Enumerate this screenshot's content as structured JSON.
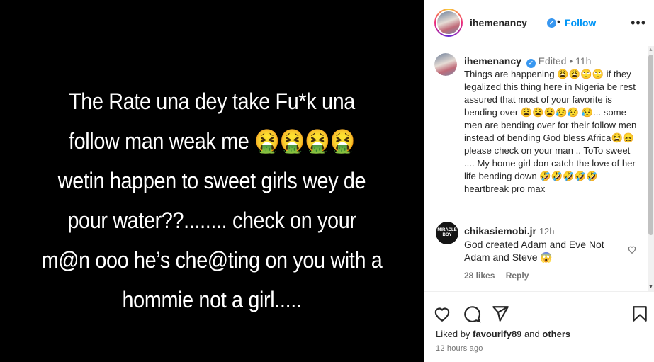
{
  "post": {
    "story_text": "The Rate una dey take Fu*k una\nfollow man weak me 🤮🤮🤮🤮\nwetin happen to sweet girls wey de\npour water??........ check on your\nm@n ooo he’s che@ting on you with a\nhommie not a girl....."
  },
  "header": {
    "username": "ihemenancy",
    "verified_symbol": "✓",
    "separator": "•",
    "follow_label": "Follow",
    "more_icon": "more-options-icon",
    "more_glyph": "•••"
  },
  "caption": {
    "username": "ihemenancy",
    "edited": "Edited",
    "dot": "•",
    "time": "11h",
    "text": "Things are happening 😩😩🙄🙄 if they legalized this thing here in Nigeria be rest assured that most of your favorite is bending over 😩😩😩😥😥 😥... some men are bending over for their follow men instead of bending God bless Africa😫😖 please check on your man .. ToTo sweet .... My home girl don catch the love of her life bending down 🤣🤣🤣🤣🤣 heartbreak pro max"
  },
  "comment": {
    "username": "chikasiemobi.jr",
    "time": "12h",
    "avatar_text": "MIRACLE\nBOY",
    "text": "God created Adam and Eve Not Adam and Steve 😱",
    "likes": "28 likes",
    "reply_label": "Reply"
  },
  "footer": {
    "liked_by_prefix": "Liked by",
    "liked_by_user": "favourify89",
    "liked_by_and": "and",
    "liked_by_others": "others",
    "timestamp": "12 hours ago"
  },
  "icons": [
    "heart-icon",
    "comment-icon",
    "share-icon",
    "save-icon",
    "verified-badge-icon"
  ],
  "colors": {
    "accent": "#0095f6",
    "verified": "#3897f0",
    "story_bg": "#000000",
    "muted": "#737373"
  }
}
